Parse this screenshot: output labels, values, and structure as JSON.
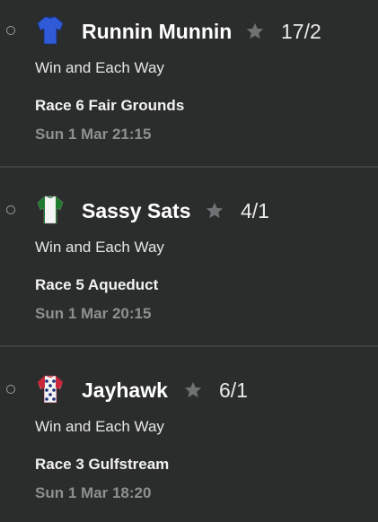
{
  "selections": [
    {
      "horse": "Runnin Munnin",
      "odds": "17/2",
      "market": "Win and Each Way",
      "race": "Race 6 Fair Grounds",
      "time": "Sun 1 Mar 21:15",
      "silk_icon": "blue-jockey-silk-icon"
    },
    {
      "horse": "Sassy Sats",
      "odds": "4/1",
      "market": "Win and Each Way",
      "race": "Race 5 Aqueduct",
      "time": "Sun 1 Mar 20:15",
      "silk_icon": "green-white-jockey-silk-icon"
    },
    {
      "horse": "Jayhawk",
      "odds": "6/1",
      "market": "Win and Each Way",
      "race": "Race 3 Gulfstream",
      "time": "Sun 1 Mar 18:20",
      "silk_icon": "red-white-blue-stars-jockey-silk-icon"
    }
  ],
  "colors": {
    "background": "#2b2d2d",
    "divider": "#3f4242",
    "star": "#6e7272",
    "muted_text": "#8c9090"
  }
}
